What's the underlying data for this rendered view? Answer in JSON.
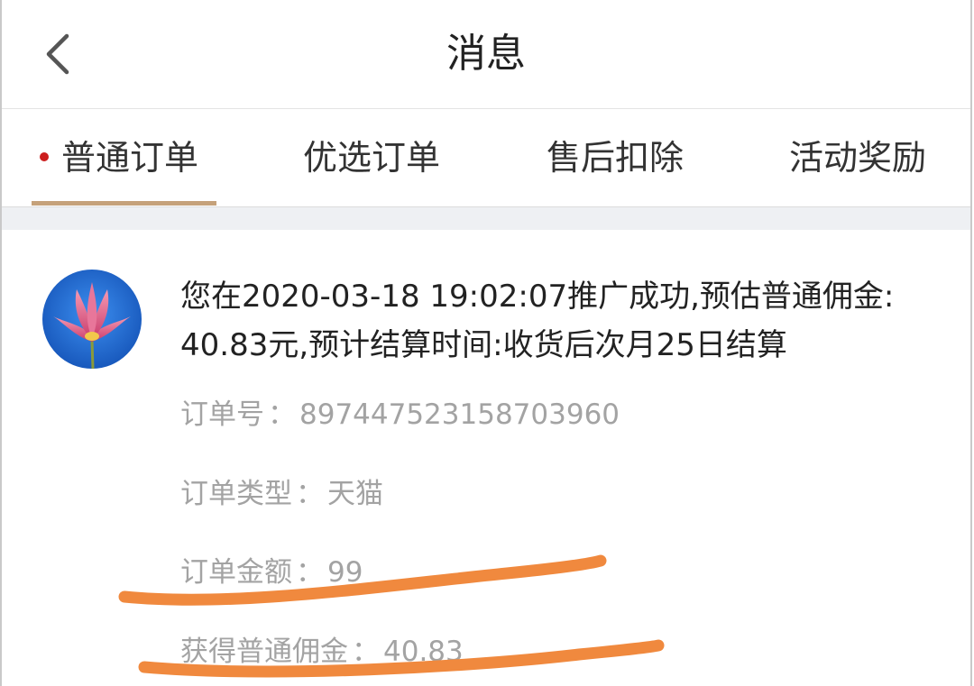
{
  "header": {
    "title": "消息"
  },
  "tabs": [
    {
      "label": "普通订单",
      "active": true,
      "has_dot": true
    },
    {
      "label": "优选订单",
      "active": false
    },
    {
      "label": "售后扣除",
      "active": false
    },
    {
      "label": "活动奖励",
      "active": false
    }
  ],
  "colors": {
    "accent_underline": "#c5a17a",
    "unread_dot": "#cc1d1d",
    "highlight_stroke": "#f0893e",
    "avatar_bg": "#1f6fd6"
  },
  "message": {
    "avatar_icon": "lotus-flower-avatar",
    "text_line1": "您在2020-03-18 19:02:07推广成功,预估普通佣金:",
    "text_line2": "40.83元,预计结算时间:收货后次月25日结算",
    "details": [
      {
        "label": "订单号",
        "sep": "：",
        "value": "897447523158703960"
      },
      {
        "label": "订单类型",
        "sep": "：",
        "value": "天猫"
      },
      {
        "label": "订单金额",
        "sep": "：",
        "value": "99"
      },
      {
        "label": "获得普通佣金",
        "sep": "：",
        "value": "40.83"
      }
    ]
  }
}
